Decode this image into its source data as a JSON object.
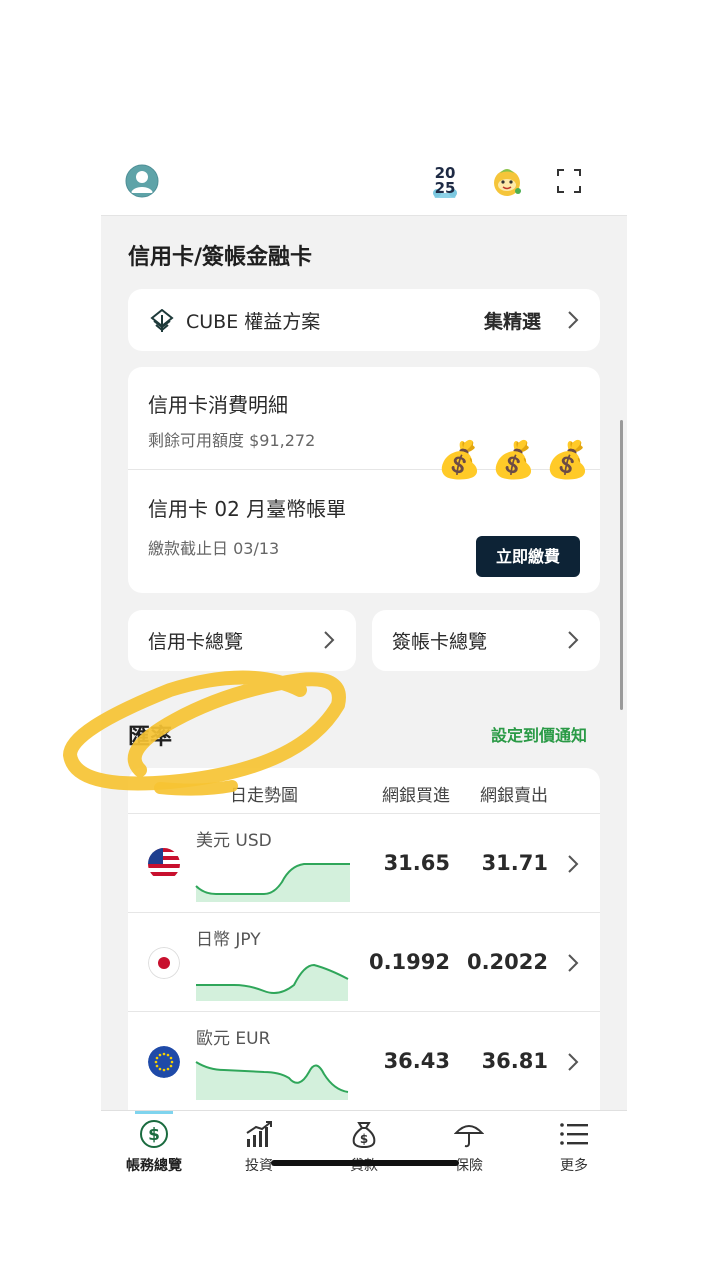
{
  "topbar": {
    "year_badge_line1": "20",
    "year_badge_line2": "25",
    "icons": [
      "avatar-icon",
      "year-2025-badge-icon",
      "mascot-icon",
      "scan-icon"
    ]
  },
  "credit": {
    "section_title": "信用卡/簽帳金融卡",
    "cube_label": "CUBE 權益方案",
    "cube_right": "集精選",
    "details_title": "信用卡消費明細",
    "details_sub": "剩餘可用額度 $91,272",
    "bill_title": "信用卡 02 月臺幣帳單",
    "bill_sub": "繳款截止日 03/13",
    "pay_button": "立即繳費",
    "overview_card": "信用卡總覽",
    "overview_debit": "簽帳卡總覽"
  },
  "stickers": [
    "💰",
    "💰",
    "💰"
  ],
  "rates": {
    "section_title": "匯率",
    "alert_link": "設定到價通知",
    "col_trend": "日走勢圖",
    "col_buy": "網銀買進",
    "col_sell": "網銀賣出",
    "rows": [
      {
        "name": "美元 USD",
        "buy": "31.65",
        "sell": "31.71"
      },
      {
        "name": "日幣 JPY",
        "buy": "0.1992",
        "sell": "0.2022"
      },
      {
        "name": "歐元 EUR",
        "buy": "36.43",
        "sell": "36.81"
      }
    ]
  },
  "nav": {
    "items": [
      {
        "label": "帳務總覽",
        "icon": "dollar-circle-icon"
      },
      {
        "label": "投資",
        "icon": "chart-up-icon"
      },
      {
        "label": "貸款",
        "icon": "money-bag-icon"
      },
      {
        "label": "保險",
        "icon": "umbrella-icon"
      },
      {
        "label": "更多",
        "icon": "menu-list-icon"
      }
    ]
  },
  "colors": {
    "accent_green": "#2a9a46",
    "pay_button": "#0d2336",
    "annotation_yellow": "#f6c333"
  }
}
